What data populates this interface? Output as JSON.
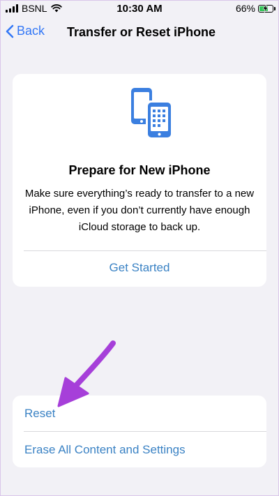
{
  "status_bar": {
    "carrier": "BSNL",
    "time": "10:30 AM",
    "battery_percent": "66%",
    "battery_level": 0.66
  },
  "nav": {
    "back_label": "Back",
    "title": "Transfer or Reset iPhone"
  },
  "prepare": {
    "title": "Prepare for New iPhone",
    "description": "Make sure everything’s ready to transfer to a new iPhone, even if you don’t currently have enough iCloud storage to back up.",
    "action_label": "Get Started",
    "icon": "phones-transfer-icon"
  },
  "reset_list": {
    "items": [
      {
        "label": "Reset"
      },
      {
        "label": "Erase All Content and Settings"
      }
    ]
  },
  "colors": {
    "accent": "#3478f6",
    "link": "#3a82c4",
    "background": "#f2f1f6",
    "annotation": "#a63fd9",
    "battery": "#34c759"
  }
}
